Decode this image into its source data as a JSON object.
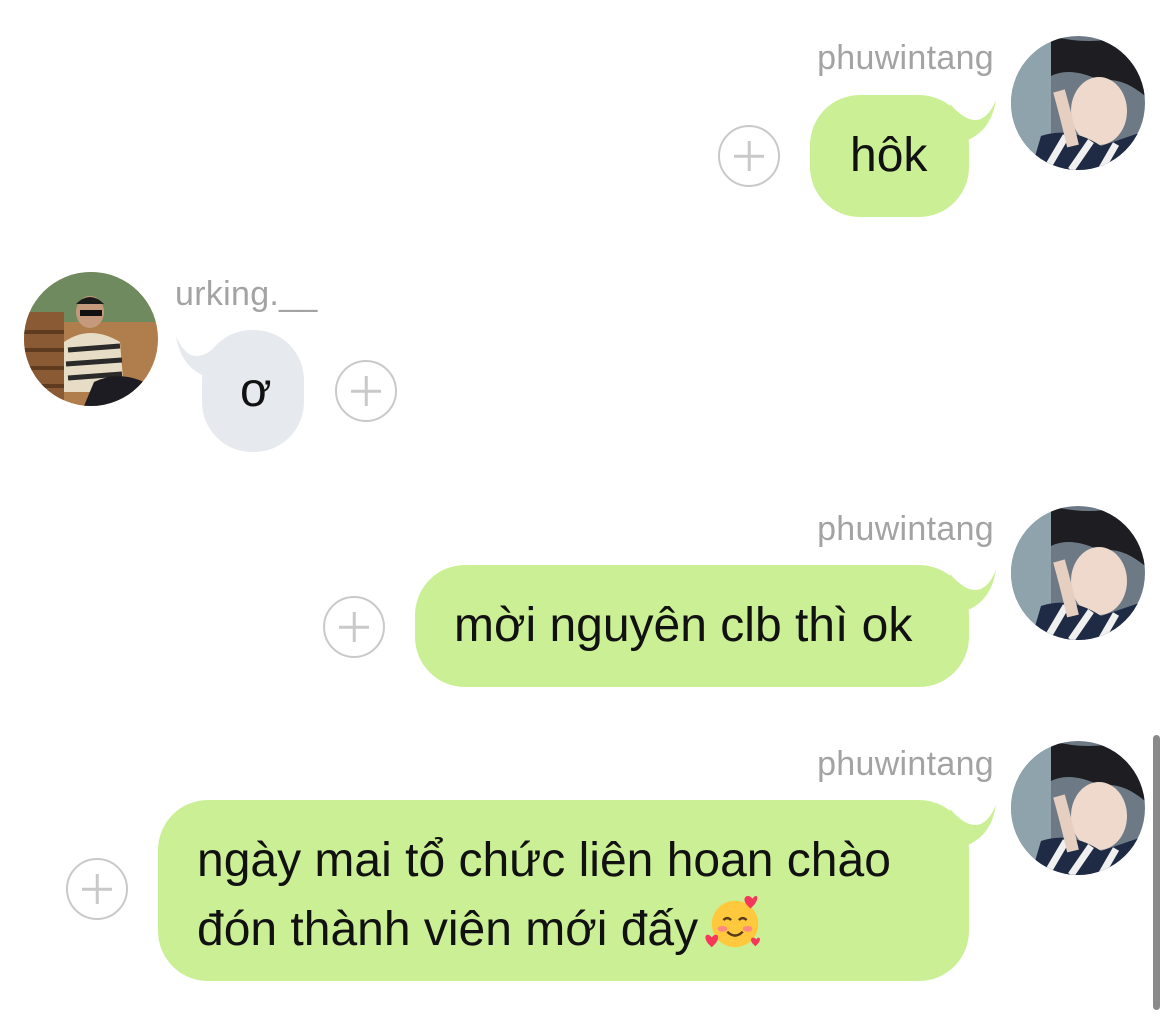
{
  "messages": [
    {
      "sender": "phuwintang",
      "direction": "outgoing",
      "text": "hôk"
    },
    {
      "sender": "urking.__",
      "direction": "incoming",
      "text": "ơ"
    },
    {
      "sender": "phuwintang",
      "direction": "outgoing",
      "text": "mời nguyên clb thì ok"
    },
    {
      "sender": "phuwintang",
      "direction": "outgoing",
      "lines": [
        "ngày mai tổ chức liên hoan chào",
        "đón thành viên mới đấy"
      ],
      "emoji": "smiling-face-with-hearts-icon"
    }
  ],
  "colors": {
    "outgoing_bubble": "#cbef95",
    "incoming_bubble": "#e6e9ee",
    "username_text": "#a3a3a3",
    "add_icon": "#c9c9c9"
  }
}
